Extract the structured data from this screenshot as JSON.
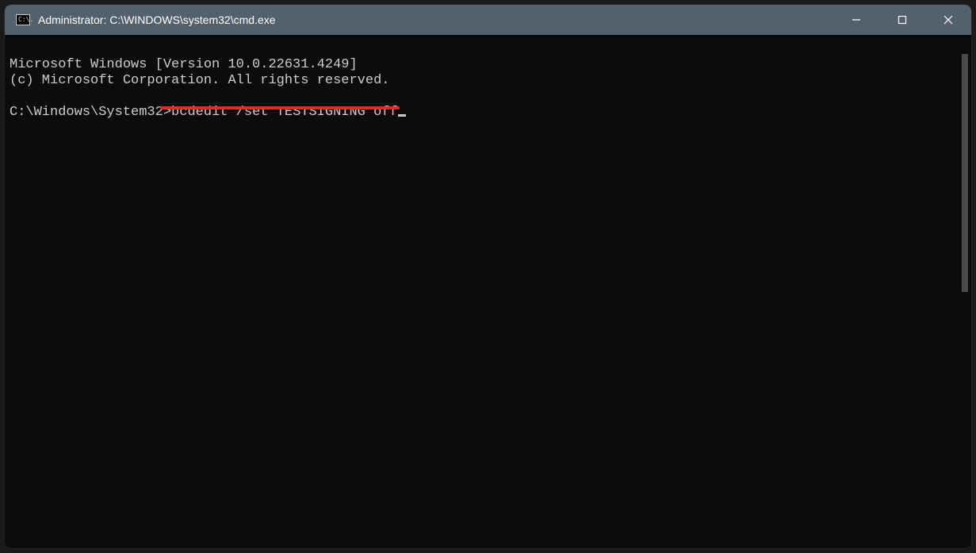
{
  "window": {
    "title": "Administrator: C:\\WINDOWS\\system32\\cmd.exe",
    "icon_glyph": "C:\\."
  },
  "terminal": {
    "line1": "Microsoft Windows [Version 10.0.22631.4249]",
    "line2": "(c) Microsoft Corporation. All rights reserved.",
    "blank": "",
    "prompt": "C:\\Windows\\System32>",
    "command": "bcdedit /set TESTSIGNING off"
  },
  "annotation": {
    "color": "#e22b2b"
  }
}
